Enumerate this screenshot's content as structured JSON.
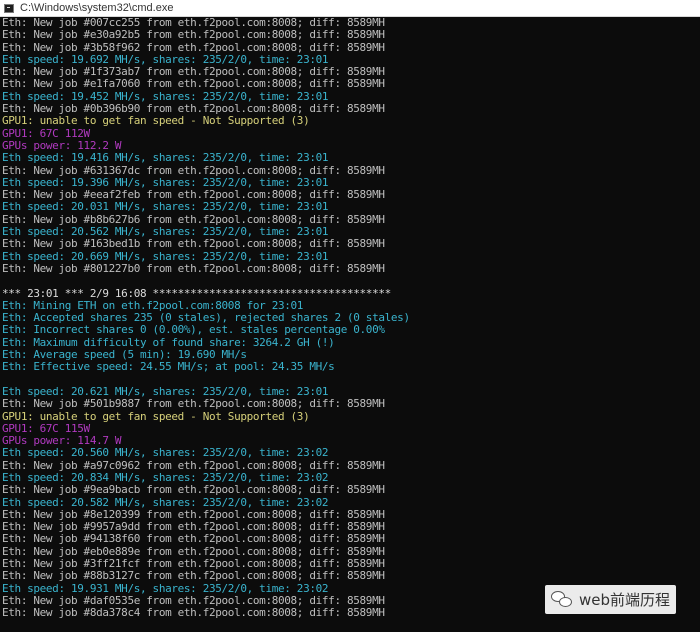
{
  "window": {
    "title": "C:\\Windows\\system32\\cmd.exe",
    "icon": "cmd-icon"
  },
  "colors": {
    "gray": "#bfbfbf",
    "cyan": "#3ab4ce",
    "yellow": "#d6d07a",
    "magenta": "#b13ac0",
    "white": "#dcdcdc"
  },
  "console": {
    "lines": [
      {
        "text": "Eth: New job #007cc255 from eth.f2pool.com:8008; diff: 8589MH",
        "color": "gray"
      },
      {
        "text": "Eth: New job #e30a92b5 from eth.f2pool.com:8008; diff: 8589MH",
        "color": "gray"
      },
      {
        "text": "Eth: New job #3b58f962 from eth.f2pool.com:8008; diff: 8589MH",
        "color": "gray"
      },
      {
        "text": "Eth speed: 19.692 MH/s, shares: 235/2/0, time: 23:01",
        "color": "cyan"
      },
      {
        "text": "Eth: New job #1f373ab7 from eth.f2pool.com:8008; diff: 8589MH",
        "color": "gray"
      },
      {
        "text": "Eth: New job #e1fa7060 from eth.f2pool.com:8008; diff: 8589MH",
        "color": "gray"
      },
      {
        "text": "Eth speed: 19.452 MH/s, shares: 235/2/0, time: 23:01",
        "color": "cyan"
      },
      {
        "text": "Eth: New job #0b396b90 from eth.f2pool.com:8008; diff: 8589MH",
        "color": "gray"
      },
      {
        "text": "GPU1: unable to get fan speed - Not Supported (3)",
        "color": "yellow"
      },
      {
        "text": "GPU1: 67C 112W",
        "color": "magenta"
      },
      {
        "text": "GPUs power: 112.2 W",
        "color": "magenta"
      },
      {
        "text": "Eth speed: 19.416 MH/s, shares: 235/2/0, time: 23:01",
        "color": "cyan"
      },
      {
        "text": "Eth: New job #631367dc from eth.f2pool.com:8008; diff: 8589MH",
        "color": "gray"
      },
      {
        "text": "Eth speed: 19.396 MH/s, shares: 235/2/0, time: 23:01",
        "color": "cyan"
      },
      {
        "text": "Eth: New job #eeaf2feb from eth.f2pool.com:8008; diff: 8589MH",
        "color": "gray"
      },
      {
        "text": "Eth speed: 20.031 MH/s, shares: 235/2/0, time: 23:01",
        "color": "cyan"
      },
      {
        "text": "Eth: New job #b8b627b6 from eth.f2pool.com:8008; diff: 8589MH",
        "color": "gray"
      },
      {
        "text": "Eth speed: 20.562 MH/s, shares: 235/2/0, time: 23:01",
        "color": "cyan"
      },
      {
        "text": "Eth: New job #163bed1b from eth.f2pool.com:8008; diff: 8589MH",
        "color": "gray"
      },
      {
        "text": "Eth speed: 20.669 MH/s, shares: 235/2/0, time: 23:01",
        "color": "cyan"
      },
      {
        "text": "Eth: New job #801227b0 from eth.f2pool.com:8008; diff: 8589MH",
        "color": "gray"
      },
      {
        "text": "",
        "color": "gray"
      },
      {
        "text": "*** 23:01 *** 2/9 16:08 **************************************",
        "color": "white"
      },
      {
        "text": "Eth: Mining ETH on eth.f2pool.com:8008 for 23:01",
        "color": "cyan"
      },
      {
        "text": "Eth: Accepted shares 235 (0 stales), rejected shares 2 (0 stales)",
        "color": "cyan"
      },
      {
        "text": "Eth: Incorrect shares 0 (0.00%), est. stales percentage 0.00%",
        "color": "cyan"
      },
      {
        "text": "Eth: Maximum difficulty of found share: 3264.2 GH (!)",
        "color": "cyan"
      },
      {
        "text": "Eth: Average speed (5 min): 19.690 MH/s",
        "color": "cyan"
      },
      {
        "text": "Eth: Effective speed: 24.55 MH/s; at pool: 24.35 MH/s",
        "color": "cyan"
      },
      {
        "text": "",
        "color": "gray"
      },
      {
        "text": "Eth speed: 20.621 MH/s, shares: 235/2/0, time: 23:01",
        "color": "cyan"
      },
      {
        "text": "Eth: New job #501b9887 from eth.f2pool.com:8008; diff: 8589MH",
        "color": "gray"
      },
      {
        "text": "GPU1: unable to get fan speed - Not Supported (3)",
        "color": "yellow"
      },
      {
        "text": "GPU1: 67C 115W",
        "color": "magenta"
      },
      {
        "text": "GPUs power: 114.7 W",
        "color": "magenta"
      },
      {
        "text": "Eth speed: 20.560 MH/s, shares: 235/2/0, time: 23:02",
        "color": "cyan"
      },
      {
        "text": "Eth: New job #a97c0962 from eth.f2pool.com:8008; diff: 8589MH",
        "color": "gray"
      },
      {
        "text": "Eth speed: 20.834 MH/s, shares: 235/2/0, time: 23:02",
        "color": "cyan"
      },
      {
        "text": "Eth: New job #9ea9bacb from eth.f2pool.com:8008; diff: 8589MH",
        "color": "gray"
      },
      {
        "text": "Eth speed: 20.582 MH/s, shares: 235/2/0, time: 23:02",
        "color": "cyan"
      },
      {
        "text": "Eth: New job #8e120399 from eth.f2pool.com:8008; diff: 8589MH",
        "color": "gray"
      },
      {
        "text": "Eth: New job #9957a9dd from eth.f2pool.com:8008; diff: 8589MH",
        "color": "gray"
      },
      {
        "text": "Eth: New job #94138f60 from eth.f2pool.com:8008; diff: 8589MH",
        "color": "gray"
      },
      {
        "text": "Eth: New job #eb0e889e from eth.f2pool.com:8008; diff: 8589MH",
        "color": "gray"
      },
      {
        "text": "Eth: New job #3ff21fcf from eth.f2pool.com:8008; diff: 8589MH",
        "color": "gray"
      },
      {
        "text": "Eth: New job #88b3127c from eth.f2pool.com:8008; diff: 8589MH",
        "color": "gray"
      },
      {
        "text": "Eth speed: 19.931 MH/s, shares: 235/2/0, time: 23:02",
        "color": "cyan"
      },
      {
        "text": "Eth: New job #daf0535e from eth.f2pool.com:8008; diff: 8589MH",
        "color": "gray"
      },
      {
        "text": "Eth: New job #8da378c4 from eth.f2pool.com:8008; diff: 8589MH",
        "color": "gray"
      }
    ]
  },
  "watermark": {
    "icon": "wechat-icon",
    "text": "web前端历程"
  }
}
